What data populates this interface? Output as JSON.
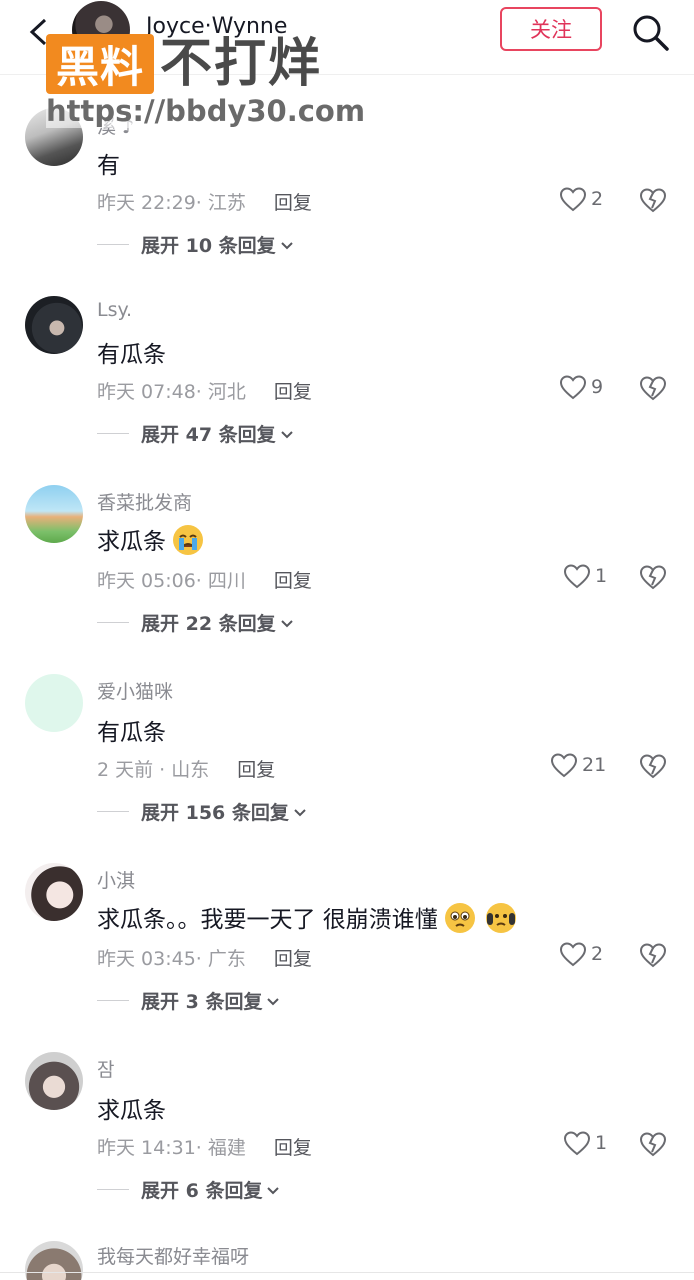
{
  "header": {
    "username": "Joyce·Wynne",
    "follow_label": "关注"
  },
  "watermark": {
    "badge": "黑料",
    "title": "不打烊",
    "url": "https://bbdy30.com"
  },
  "reply_label": "回复",
  "comments": [
    {
      "username": "溪 ♪",
      "text": "有",
      "time": "昨天 22:29",
      "location": "江苏",
      "likes": "2",
      "expand": "展开 10 条回复"
    },
    {
      "username": "Lsy.",
      "text": "有瓜条",
      "time": "昨天 07:48",
      "location": "河北",
      "likes": "9",
      "expand": "展开 47 条回复"
    },
    {
      "username": "香菜批发商",
      "text": "求瓜条",
      "time": "昨天 05:06",
      "location": "四川",
      "likes": "1",
      "expand": "展开 22 条回复"
    },
    {
      "username": "爱小猫咪",
      "text": "有瓜条",
      "time": "2 天前",
      "location": "山东",
      "likes": "21",
      "expand": "展开 156 条回复"
    },
    {
      "username": "小淇",
      "text": "求瓜条。。我要一天了 很崩溃谁懂",
      "time": "昨天 03:45",
      "location": "广东",
      "likes": "2",
      "expand": "展开 3 条回复"
    },
    {
      "username": "잠",
      "text": "求瓜条",
      "time": "昨天 14:31",
      "location": "福建",
      "likes": "1",
      "expand": "展开 6 条回复"
    },
    {
      "username": "我每天都好幸福呀"
    }
  ],
  "icons": {
    "back": "chevron-left-icon",
    "search": "search-icon",
    "like": "heart-outline-icon",
    "dislike": "broken-heart-icon",
    "expand": "chevron-down-icon"
  },
  "colors": {
    "accent": "#e8455f",
    "watermark_orange": "#f28a1f"
  }
}
